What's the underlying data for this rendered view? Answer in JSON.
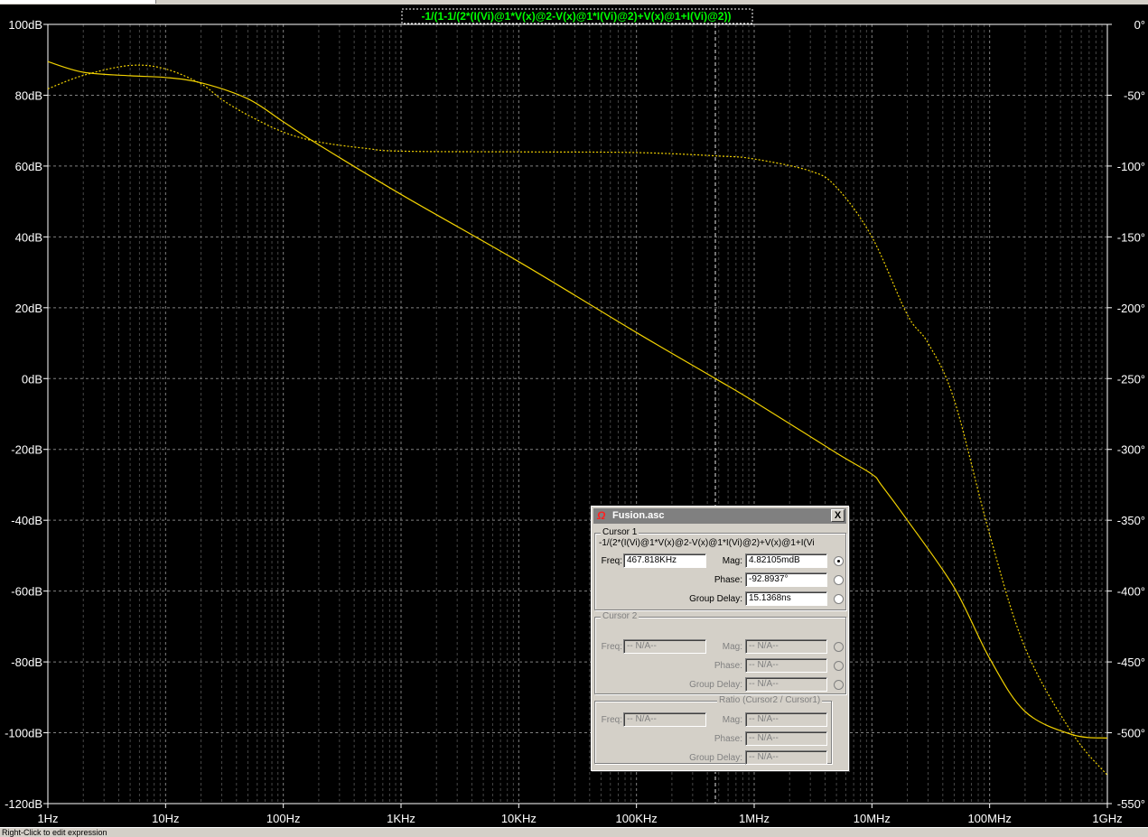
{
  "window": {
    "trace_expression": "-1/(1-1/(2*(I(Vi)@1*V(x)@2-V(x)@1*I(Vi)@2)+V(x)@1+I(Vi)@2))",
    "status_text": "Right-Click to edit expression"
  },
  "colors": {
    "background": "#000000",
    "trace": "#f0d000",
    "grid": "#808080",
    "axis_text": "#ffffff",
    "expression_text": "#00ff00"
  },
  "chart_data": {
    "type": "line",
    "x_scale": "log",
    "xlim": [
      1,
      1000000000
    ],
    "x_ticks": [
      1,
      10,
      100,
      1000,
      10000,
      100000,
      1000000,
      10000000,
      100000000,
      1000000000
    ],
    "x_tick_labels": [
      "1Hz",
      "10Hz",
      "100Hz",
      "1KHz",
      "10KHz",
      "100KHz",
      "1MHz",
      "10MHz",
      "100MHz",
      "1GHz"
    ],
    "y_left": {
      "unit": "dB",
      "ylim": [
        -120,
        100
      ],
      "ticks": [
        100,
        80,
        60,
        40,
        20,
        0,
        -20,
        -40,
        -60,
        -80,
        -100,
        -120
      ],
      "tick_labels": [
        "100dB",
        "80dB",
        "60dB",
        "40dB",
        "20dB",
        "0dB",
        "-20dB",
        "-40dB",
        "-60dB",
        "-80dB",
        "-100dB",
        "-120dB"
      ]
    },
    "y_right": {
      "unit": "deg",
      "ylim": [
        -550,
        0
      ],
      "ticks": [
        0,
        -50,
        -100,
        -150,
        -200,
        -250,
        -300,
        -350,
        -400,
        -450,
        -500,
        -550
      ],
      "tick_labels": [
        "0°",
        "-50°",
        "-100°",
        "-150°",
        "-200°",
        "-250°",
        "-300°",
        "-350°",
        "-400°",
        "-450°",
        "-500°",
        "-550°"
      ]
    },
    "grid": true,
    "cursor_frequency": 467818,
    "series": [
      {
        "axis": "left",
        "style": "solid",
        "x": [
          1,
          2,
          5,
          10,
          20,
          50,
          100,
          200,
          1000,
          10000,
          100000,
          467818,
          1000000,
          5000000,
          10000000,
          12000000,
          20000000,
          50000000,
          100000000,
          200000000,
          500000000,
          1000000000
        ],
        "y": [
          89.5,
          86.5,
          85.5,
          85,
          83.5,
          79,
          72.5,
          66,
          52,
          33,
          13,
          0,
          -6.5,
          -21,
          -27,
          -30,
          -40,
          -59,
          -79,
          -94,
          -100.5,
          -101.5
        ]
      },
      {
        "axis": "right",
        "style": "dashed",
        "x": [
          1,
          2,
          5,
          10,
          20,
          30,
          50,
          100,
          200,
          500,
          1000,
          10000,
          100000,
          500000,
          1000000,
          3000000,
          5000000,
          10000000,
          20000000,
          30000000,
          50000000,
          100000000,
          200000000,
          500000000,
          1000000000
        ],
        "y": [
          -45.5,
          -36,
          -29,
          -31.5,
          -42,
          -53,
          -64,
          -76,
          -83,
          -87.5,
          -89.5,
          -90,
          -90.5,
          -92.9,
          -95,
          -103.5,
          -115,
          -150,
          -205,
          -225,
          -265,
          -360,
          -440,
          -500,
          -530
        ]
      }
    ]
  },
  "cursor_dialog": {
    "title": "Fusion.asc",
    "close_label": "X",
    "cursor1": {
      "legend": "Cursor 1",
      "expression": "-1/(2*(I(Vi)@1*V(x)@2-V(x)@1*I(Vi)@2)+V(x)@1+I(Vi",
      "freq_label": "Freq:",
      "freq_value": "467.818KHz",
      "mag_label": "Mag:",
      "mag_value": "4.82105mdB",
      "phase_label": "Phase:",
      "phase_value": "-92.8937°",
      "gd_label": "Group Delay:",
      "gd_value": "15.1368ns"
    },
    "cursor2": {
      "legend": "Cursor 2",
      "freq_label": "Freq:",
      "freq_value": "-- N/A--",
      "mag_label": "Mag:",
      "mag_value": "-- N/A--",
      "phase_label": "Phase:",
      "phase_value": "-- N/A--",
      "gd_label": "Group Delay:",
      "gd_value": "-- N/A--"
    },
    "ratio": {
      "legend": "Ratio (Cursor2 / Cursor1)",
      "freq_label": "Freq:",
      "freq_value": "-- N/A--",
      "mag_label": "Mag:",
      "mag_value": "-- N/A--",
      "phase_label": "Phase:",
      "phase_value": "-- N/A--",
      "gd_label": "Group Delay:",
      "gd_value": "-- N/A--"
    }
  }
}
